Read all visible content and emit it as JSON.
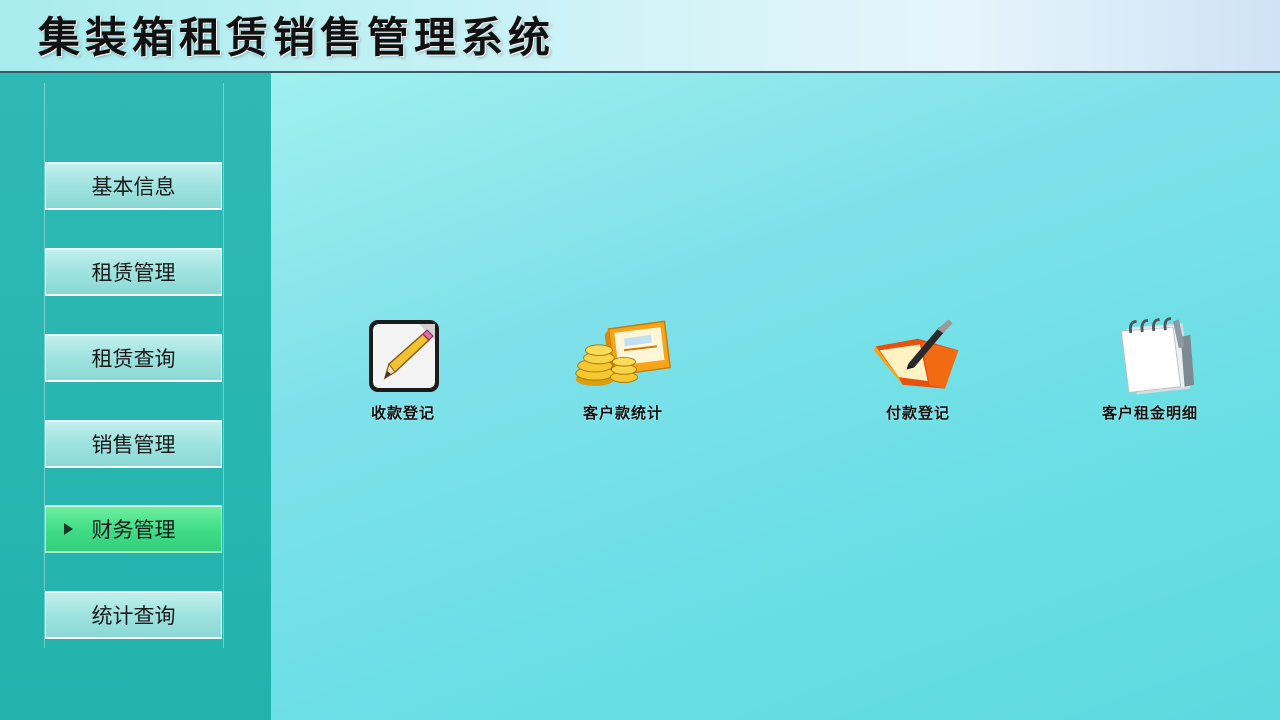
{
  "app": {
    "title": "集装箱租赁销售管理系统"
  },
  "sidebar": {
    "items": [
      {
        "label": "基本信息",
        "active": false
      },
      {
        "label": "租赁管理",
        "active": false
      },
      {
        "label": "租赁查询",
        "active": false
      },
      {
        "label": "销售管理",
        "active": false
      },
      {
        "label": "财务管理",
        "active": true
      },
      {
        "label": "统计查询",
        "active": false
      }
    ]
  },
  "main": {
    "tiles": [
      {
        "label": "收款登记",
        "icon": "edit-document-icon"
      },
      {
        "label": "客户款统计",
        "icon": "coins-card-icon"
      },
      {
        "label": "付款登记",
        "icon": "folder-pen-icon"
      },
      {
        "label": "客户租金明细",
        "icon": "spiral-notepad-icon"
      }
    ]
  },
  "colors": {
    "accent_active": "#3fdc86",
    "sidebar_bg": "#22b3ad",
    "main_bg": "#68dfe4"
  }
}
